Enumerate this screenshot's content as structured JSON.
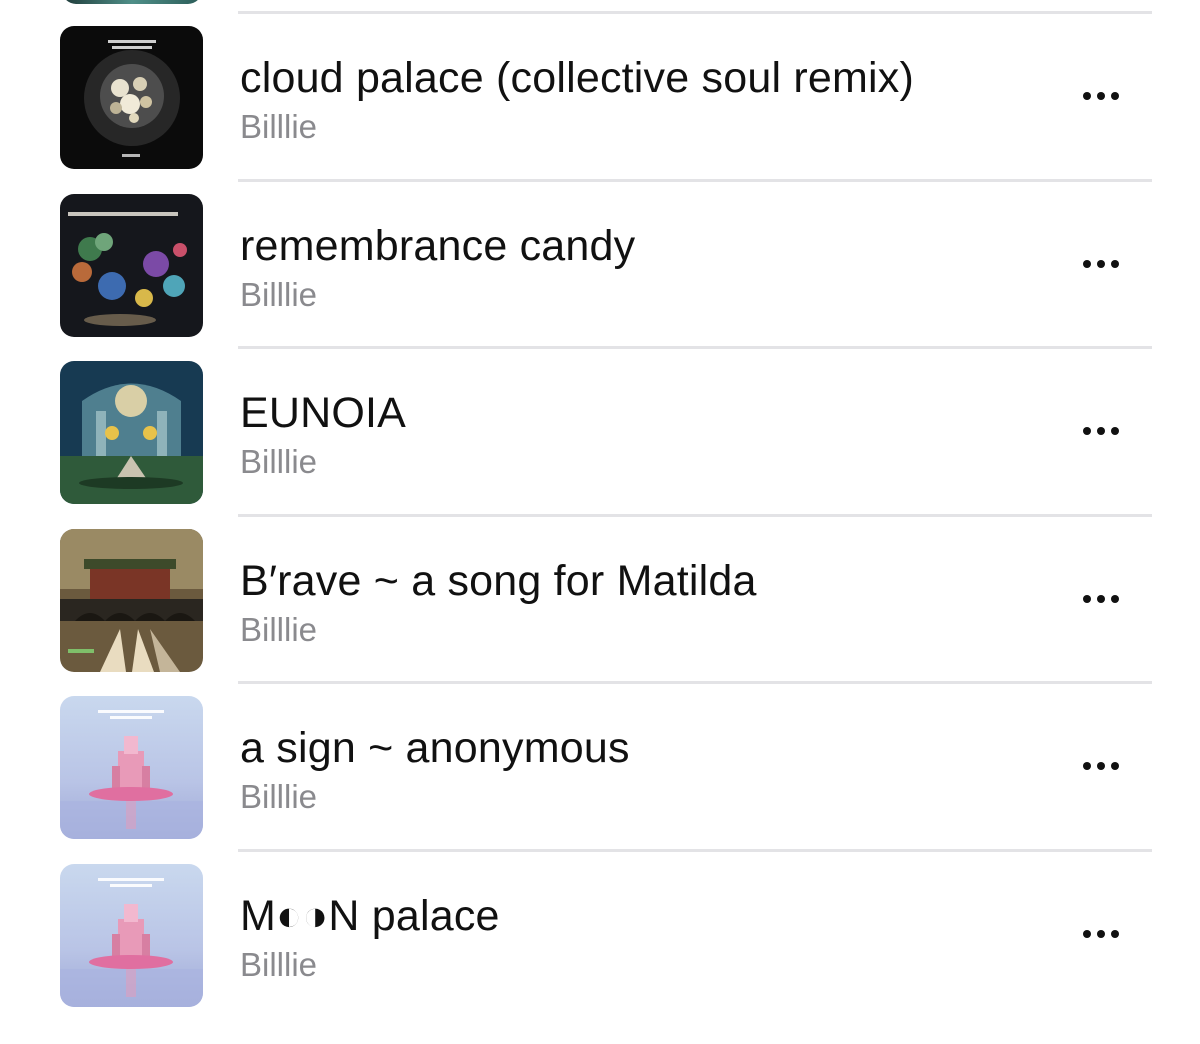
{
  "tracks": [
    {
      "title": "cloud palace (collective soul remix)",
      "artist": "Billlie",
      "artwork_icon": "album-art-cloud-palace-icon",
      "more_icon": "ellipsis-icon"
    },
    {
      "title": "remembrance candy",
      "artist": "Billlie",
      "artwork_icon": "album-art-of-all-we-have-lost-icon",
      "more_icon": "ellipsis-icon"
    },
    {
      "title": "EUNOIA",
      "artist": "Billlie",
      "artwork_icon": "album-art-eunoia-icon",
      "more_icon": "ellipsis-icon"
    },
    {
      "title": "B′rave ~ a song for Matilda",
      "artist": "Billlie",
      "artwork_icon": "album-art-brave-icon",
      "more_icon": "ellipsis-icon"
    },
    {
      "title": "a sign ~ anonymous",
      "artist": "Billlie",
      "artwork_icon": "album-art-collective-soul-pink-icon",
      "more_icon": "ellipsis-icon"
    },
    {
      "title": "M◐◑N palace",
      "artist": "Billlie",
      "artwork_icon": "album-art-collective-soul-pink-icon",
      "more_icon": "ellipsis-icon"
    }
  ],
  "colors": {
    "title_text": "#111111",
    "artist_text": "#8a8a8e",
    "separator": "#e3e3e6",
    "background": "#ffffff"
  }
}
